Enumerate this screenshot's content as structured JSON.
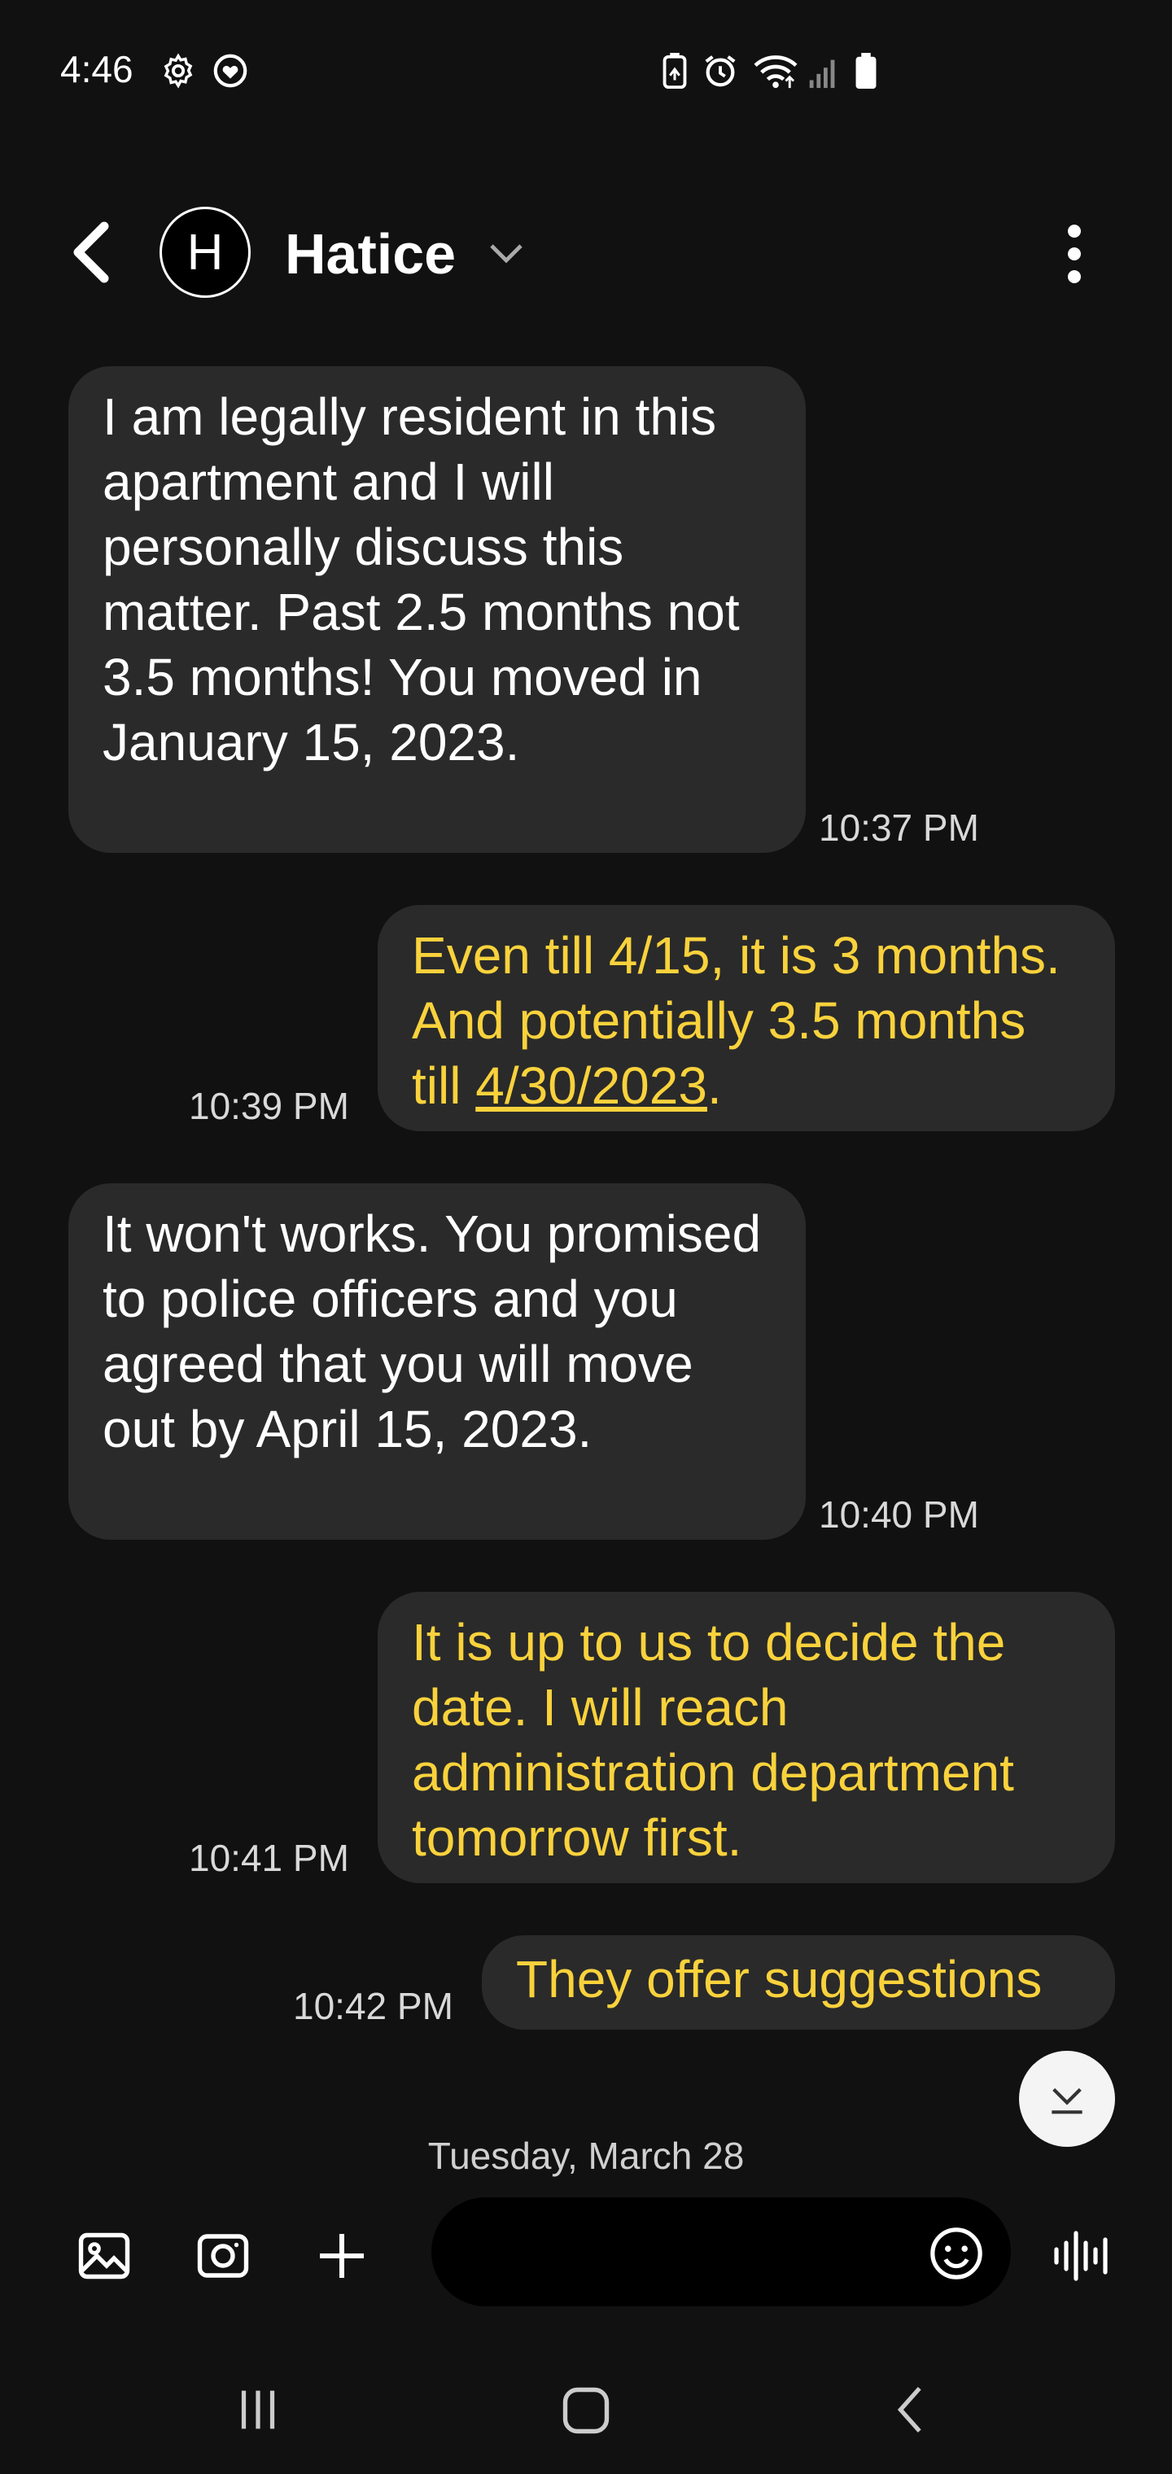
{
  "status_bar": {
    "time": "4:46",
    "left_icons": [
      "gear-icon",
      "heart-shield-icon"
    ],
    "right_icons": [
      "battery-saver-icon",
      "alarm-icon",
      "wifi-icon",
      "signal-icon",
      "battery-icon"
    ]
  },
  "header": {
    "avatar_initial": "H",
    "contact_name": "Hatice"
  },
  "colors": {
    "background": "#111111",
    "bubble": "#2a2a2a",
    "incoming_text": "#ffffff",
    "outgoing_text": "#f9d23c"
  },
  "messages": [
    {
      "direction": "incoming",
      "text": "I am legally resident in this apartment and I will personally discuss this matter. Past 2.5 months not 3.5 months! You moved in January 15, 2023.",
      "time": "10:37 PM"
    },
    {
      "direction": "outgoing",
      "text_before_link": "Even till 4/15, it is 3 months. And potentially 3.5 months till ",
      "link": "4/30/2023",
      "text_after_link": ".",
      "time": "10:39 PM"
    },
    {
      "direction": "incoming",
      "text": "It won't works. You promised to police officers and you agreed that you will move out by April 15, 2023.",
      "time": "10:40 PM"
    },
    {
      "direction": "outgoing",
      "text": "It is up to us to decide the date. I will reach administration department tomorrow first.",
      "time": "10:41 PM"
    },
    {
      "direction": "outgoing",
      "text": "They offer suggestions",
      "time": "10:42 PM"
    }
  ],
  "date_divider": "Tuesday, March 28",
  "input_bar": {
    "icons": [
      "gallery-icon",
      "camera-icon",
      "plus-icon",
      "emoji-icon",
      "voice-icon"
    ],
    "placeholder": ""
  },
  "nav_bar": {
    "icons": [
      "recent-apps-icon",
      "home-icon",
      "back-icon"
    ]
  }
}
